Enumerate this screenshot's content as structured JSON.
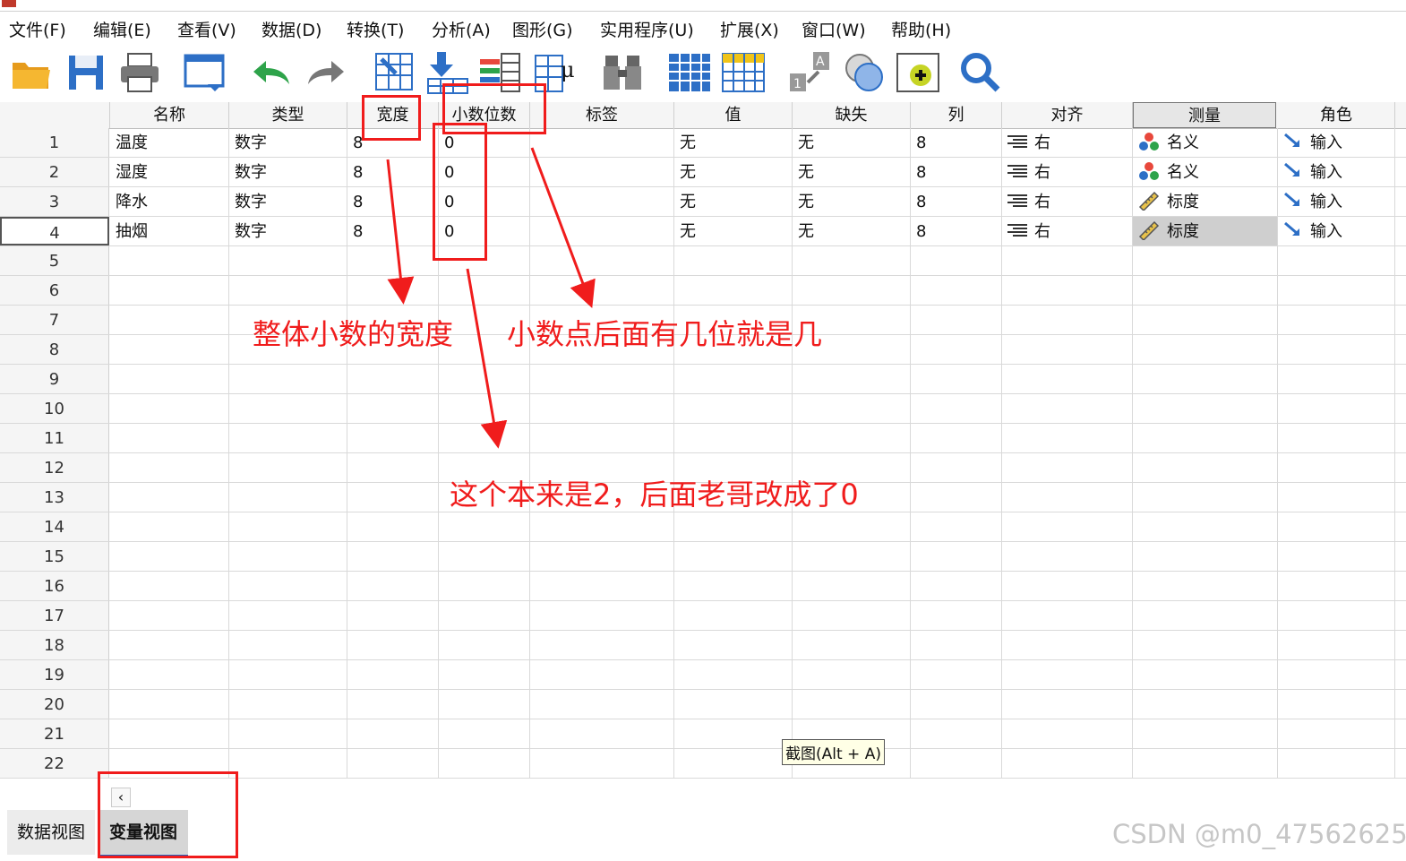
{
  "menu": [
    "文件(F)",
    "编辑(E)",
    "查看(V)",
    "数据(D)",
    "转换(T)",
    "分析(A)",
    "图形(G)",
    "实用程序(U)",
    "扩展(X)",
    "窗口(W)",
    "帮助(H)"
  ],
  "toolbar_icons": [
    "open-folder-icon",
    "save-icon",
    "print-icon",
    "recall-dialog-icon",
    "undo-icon",
    "redo-icon",
    "goto-case-icon",
    "goto-variable-icon",
    "variables-icon",
    "descriptive-stats-icon",
    "find-icon",
    "insert-cases-icon",
    "insert-variable-icon",
    "split-file-icon",
    "select-cases-icon",
    "value-labels-icon",
    "use-sets-icon",
    "search-icon"
  ],
  "headers": [
    "名称",
    "类型",
    "宽度",
    "小数位数",
    "标签",
    "值",
    "缺失",
    "列",
    "对齐",
    "测量",
    "角色"
  ],
  "rows": [
    {
      "num": "1",
      "name": "温度",
      "type": "数字",
      "width": "8",
      "decimals": "0",
      "label": "",
      "values": "无",
      "missing": "无",
      "columns": "8",
      "align": "右",
      "measure": "名义",
      "measure_icon": "nominal-icon",
      "role": "输入"
    },
    {
      "num": "2",
      "name": "湿度",
      "type": "数字",
      "width": "8",
      "decimals": "0",
      "label": "",
      "values": "无",
      "missing": "无",
      "columns": "8",
      "align": "右",
      "measure": "名义",
      "measure_icon": "nominal-icon",
      "role": "输入"
    },
    {
      "num": "3",
      "name": "降水",
      "type": "数字",
      "width": "8",
      "decimals": "0",
      "label": "",
      "values": "无",
      "missing": "无",
      "columns": "8",
      "align": "右",
      "measure": "标度",
      "measure_icon": "scale-ruler-icon",
      "role": "输入"
    },
    {
      "num": "4",
      "name": "抽烟",
      "type": "数字",
      "width": "8",
      "decimals": "0",
      "label": "",
      "values": "无",
      "missing": "无",
      "columns": "8",
      "align": "右",
      "measure": "标度",
      "measure_icon": "scale-ruler-icon",
      "role": "输入"
    }
  ],
  "empty_row_numbers": [
    "5",
    "6",
    "7",
    "8",
    "9",
    "10",
    "11",
    "12",
    "13",
    "14",
    "15",
    "16",
    "17",
    "18",
    "19",
    "20",
    "21",
    "22"
  ],
  "tabs": {
    "data_view": "数据视图",
    "variable_view": "变量视图"
  },
  "annotations": {
    "width_note": "整体小数的宽度",
    "decimals_note": "小数点后面有几位就是几",
    "changed_note": "这个本来是2，后面老哥改成了0"
  },
  "tooltip": "截图(Alt + A)",
  "watermark": "CSDN @m0_47562625",
  "colors": {
    "annotation": "#f01c1c",
    "selected_cell": "#cfcfcf",
    "header_bg": "#f5f5f5"
  }
}
